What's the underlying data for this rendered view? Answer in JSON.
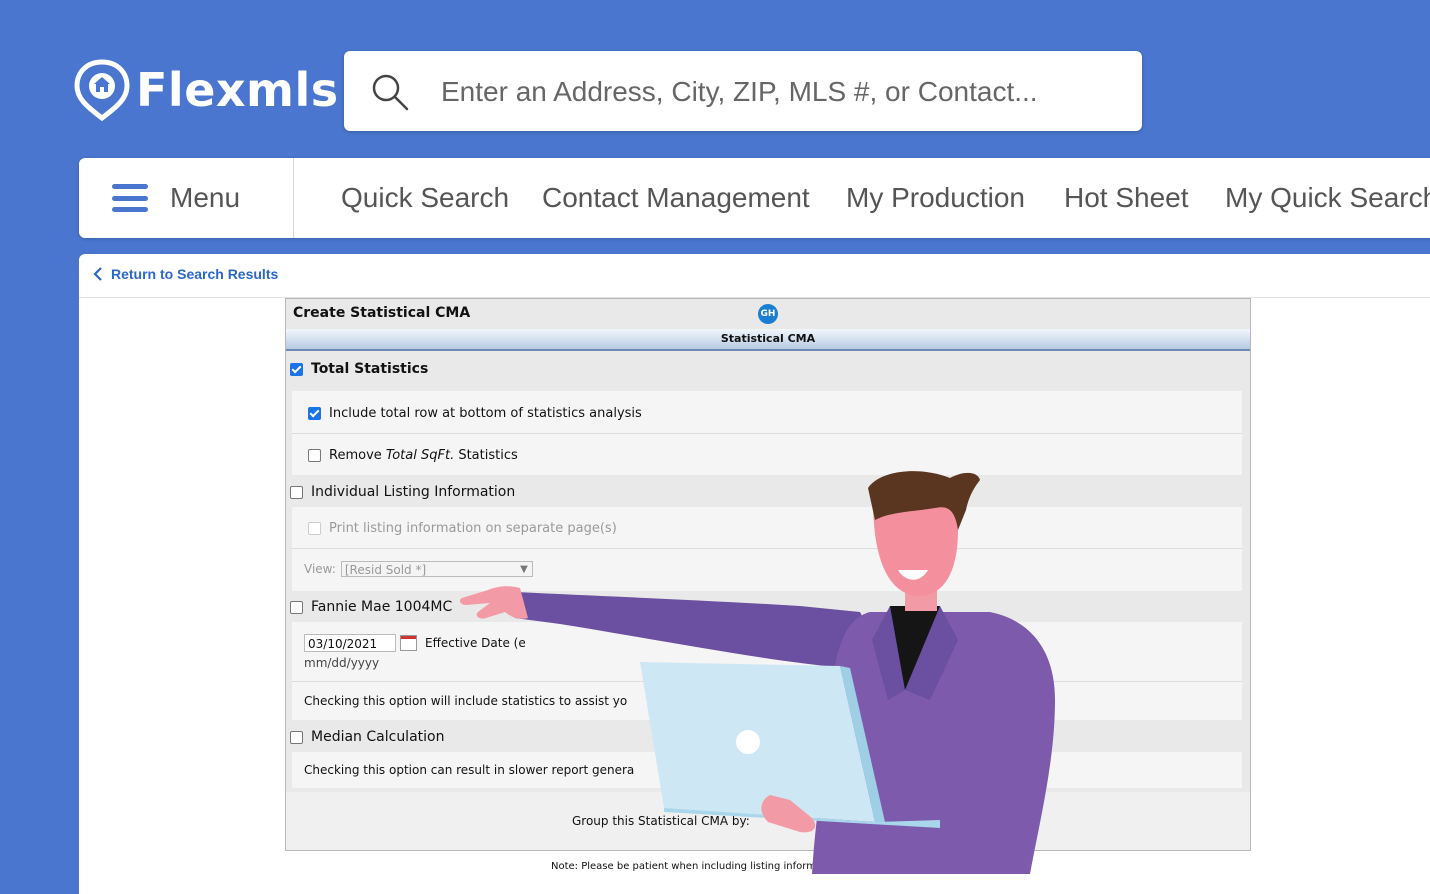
{
  "brand": {
    "name": "Flexmls"
  },
  "search": {
    "placeholder": "Enter an Address, City, ZIP, MLS #, or Contact..."
  },
  "nav": {
    "menu_label": "Menu",
    "items": [
      "Quick Search",
      "Contact Management",
      "My Production",
      "Hot Sheet",
      "My Quick Search"
    ]
  },
  "content": {
    "return_link": "Return to Search Results"
  },
  "form": {
    "title": "Create Statistical CMA",
    "badge": "GH",
    "section_bar": "Statistical CMA",
    "total_statistics": {
      "label": "Total Statistics",
      "checked": true
    },
    "include_total_row": {
      "label": "Include total row at bottom of statistics analysis",
      "checked": true
    },
    "remove_sqft": {
      "prefix": "Remove ",
      "emphasis": "Total SqFt.",
      "suffix": " Statistics",
      "checked": false
    },
    "individual_listing": {
      "label": "Individual Listing Information",
      "checked": false
    },
    "print_separate": {
      "label": "Print listing information on separate page(s)",
      "checked": false,
      "disabled": true
    },
    "view": {
      "label": "View:",
      "value": "[Resid Sold *]"
    },
    "fannie_mae": {
      "label": "Fannie Mae 1004MC",
      "checked": false
    },
    "effective_date": {
      "value": "03/10/2021",
      "label": "Effective Date (e",
      "format": "mm/dd/yyyy"
    },
    "fannie_note": "Checking this option will include statistics to assist yo",
    "median": {
      "label": "Median Calculation",
      "checked": false
    },
    "median_note": "Checking this option can result in slower report genera",
    "group_by": "Group this Statistical CMA by:"
  },
  "footer_note": "Note: Please be patient when including listing informa",
  "colors": {
    "brand_blue": "#4a76cf",
    "link_blue": "#2b67c9",
    "checkbox_blue": "#1a73e8"
  }
}
